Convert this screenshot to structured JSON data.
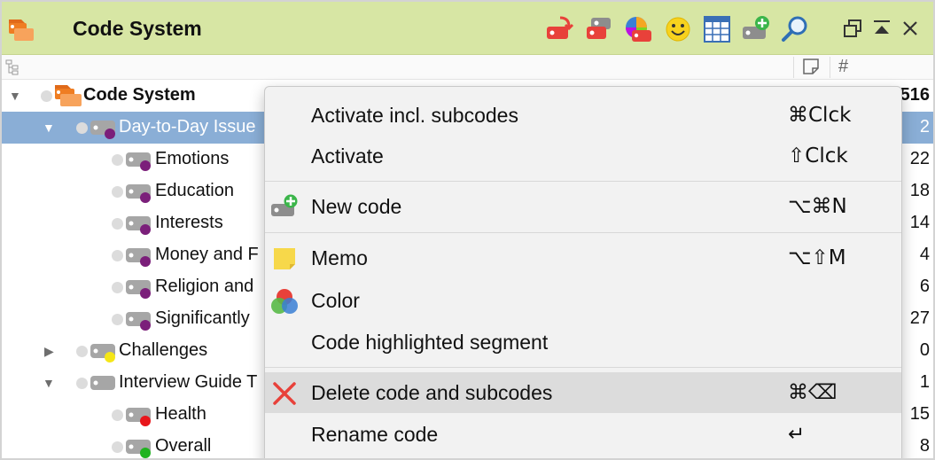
{
  "header": {
    "title": "Code System"
  },
  "toolbar": {
    "icons": [
      "code-export-icon",
      "code-set-icon",
      "color-wheel-icon",
      "smiley-icon",
      "table-icon",
      "new-code-icon",
      "search-icon"
    ],
    "window_controls": [
      "undock-icon",
      "collapse-up-icon",
      "close-icon"
    ]
  },
  "subheader": {
    "col_memo": "memo-column-icon",
    "col_count": "#"
  },
  "tree": {
    "rows": [
      {
        "label": "Code System",
        "count": "516"
      },
      {
        "label": "Day-to-Day Issue",
        "count": "2",
        "color": "#7b1f7a"
      },
      {
        "label": "Emotions",
        "count": "22",
        "color": "#7b1f7a"
      },
      {
        "label": "Education",
        "count": "18",
        "color": "#7b1f7a"
      },
      {
        "label": "Interests",
        "count": "14",
        "color": "#7b1f7a"
      },
      {
        "label": "Money and F",
        "count": "4",
        "color": "#7b1f7a"
      },
      {
        "label": "Religion and",
        "count": "6",
        "color": "#7b1f7a"
      },
      {
        "label": "Significantly",
        "count": "27",
        "color": "#7b1f7a"
      },
      {
        "label": "Challenges",
        "count": "0",
        "color": "#f5e617"
      },
      {
        "label": "Interview Guide T",
        "count": "1",
        "color": "#dcdcdc"
      },
      {
        "label": "Health",
        "count": "15",
        "color": "#e8161b"
      },
      {
        "label": "Overall",
        "count": "8",
        "color": "#1fb31f"
      }
    ]
  },
  "menu": {
    "items": [
      {
        "label": "Activate incl. subcodes",
        "shortcut": "⌘Clck"
      },
      {
        "label": "Activate",
        "shortcut": "⇧Clck"
      },
      {
        "label": "New code",
        "shortcut": "⌥⌘N"
      },
      {
        "label": "Memo",
        "shortcut": "⌥⇧M"
      },
      {
        "label": "Color",
        "shortcut": ""
      },
      {
        "label": "Code highlighted segment",
        "shortcut": ""
      },
      {
        "label": "Delete code and subcodes",
        "shortcut": "⌘⌫"
      },
      {
        "label": "Rename code",
        "shortcut": "↵"
      }
    ]
  },
  "colors": {
    "header_bg": "#d7e6a4",
    "selection": "#8aaed6",
    "menu_highlight": "#dcdcdc",
    "delete_red": "#e8413a"
  }
}
